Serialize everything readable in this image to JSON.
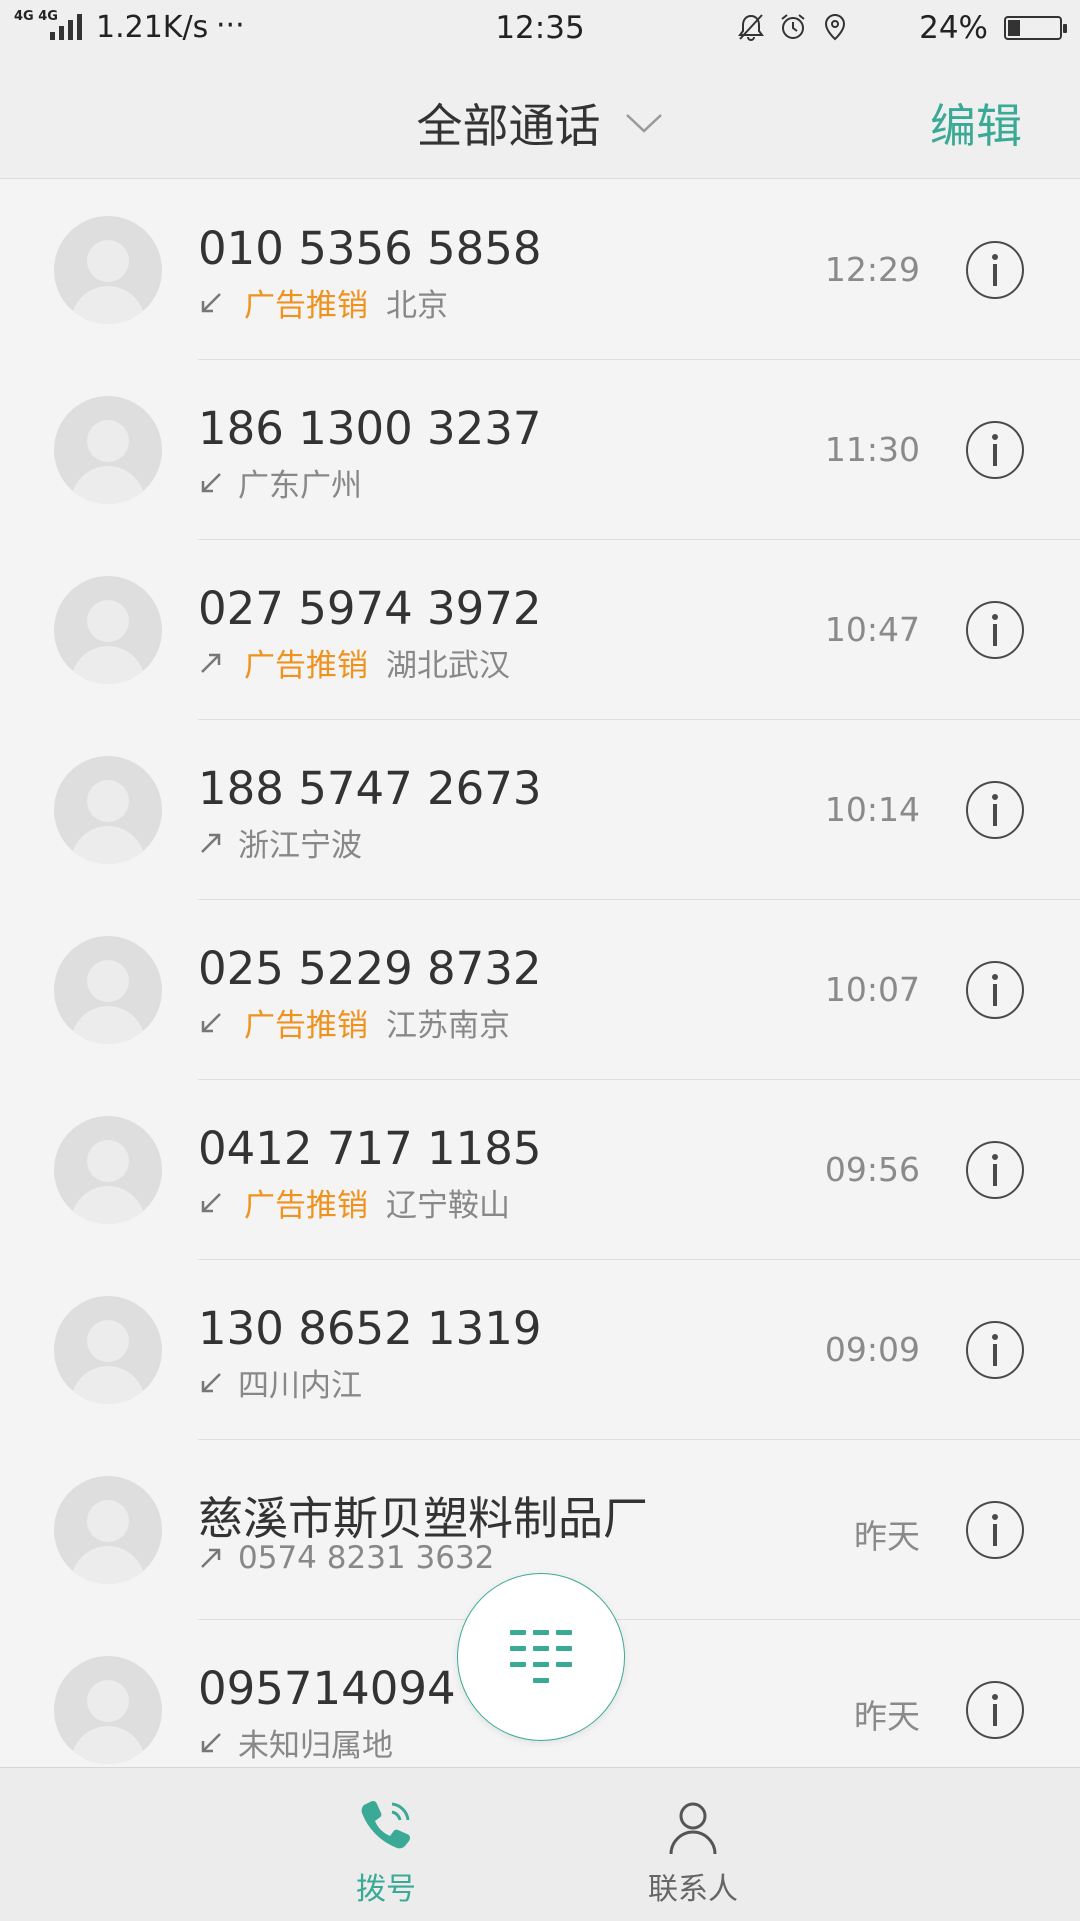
{
  "status_bar": {
    "network": "4G 4G",
    "speed": "1.21K/s",
    "dots": "···",
    "time": "12:35",
    "icons": [
      "bell-off-icon",
      "alarm-icon",
      "location-icon"
    ],
    "battery_percent": "24%",
    "battery_level": 0.24
  },
  "header": {
    "title": "全部通话",
    "edit_label": "编辑"
  },
  "calls": [
    {
      "number": "010 5356 5858",
      "direction": "incoming",
      "tag": "广告推销",
      "location": "北京",
      "time": "12:29"
    },
    {
      "number": "186 1300 3237",
      "direction": "incoming",
      "tag": "",
      "location": "广东广州",
      "time": "11:30"
    },
    {
      "number": "027 5974 3972",
      "direction": "outgoing",
      "tag": "广告推销",
      "location": "湖北武汉",
      "time": "10:47"
    },
    {
      "number": "188 5747 2673",
      "direction": "outgoing",
      "tag": "",
      "location": "浙江宁波",
      "time": "10:14"
    },
    {
      "number": "025 5229 8732",
      "direction": "incoming",
      "tag": "广告推销",
      "location": "江苏南京",
      "time": "10:07"
    },
    {
      "number": "0412 717 1185",
      "direction": "incoming",
      "tag": "广告推销",
      "location": "辽宁鞍山",
      "time": "09:56"
    },
    {
      "number": "130 8652 1319",
      "direction": "incoming",
      "tag": "",
      "location": "四川内江",
      "time": "09:09"
    },
    {
      "number": "慈溪市斯贝塑料制品厂",
      "direction": "outgoing",
      "tag": "",
      "location": "0574 8231 3632",
      "time": "昨天"
    },
    {
      "number": "095714094",
      "direction": "incoming",
      "tag": "",
      "location": "未知归属地",
      "time": "昨天"
    }
  ],
  "bottom_nav": {
    "dial_label": "拨号",
    "contacts_label": "联系人"
  },
  "colors": {
    "accent": "#3aaa96",
    "spam": "#f0921e"
  }
}
